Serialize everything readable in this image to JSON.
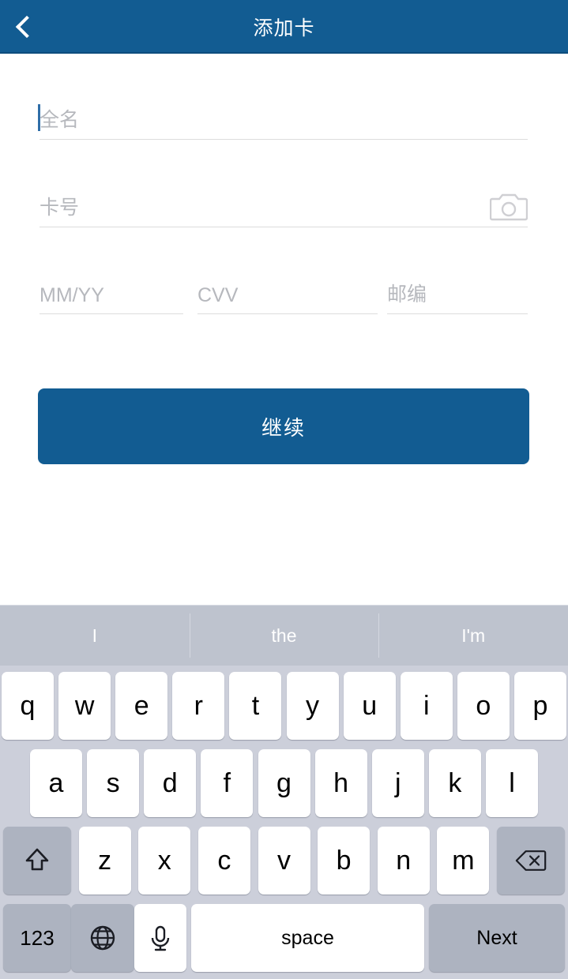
{
  "header": {
    "title": "添加卡",
    "back_icon": "chevron-left-icon",
    "background_color": "#125C92"
  },
  "form": {
    "fields": [
      {
        "name": "full-name",
        "placeholder": "全名",
        "value": "",
        "focused": true
      },
      {
        "name": "card-number",
        "placeholder": "卡号",
        "value": "",
        "focused": false,
        "trailing_icon": "camera-icon"
      },
      {
        "name": "expiry",
        "placeholder": "MM/YY",
        "value": "",
        "focused": false
      },
      {
        "name": "cvv",
        "placeholder": "CVV",
        "value": "",
        "focused": false
      },
      {
        "name": "postal-code",
        "placeholder": "邮编",
        "value": "",
        "focused": false
      }
    ],
    "submit_label": "继续",
    "submit_color": "#125C92"
  },
  "keyboard": {
    "suggestions": [
      "I",
      "the",
      "I'm"
    ],
    "row1": [
      "q",
      "w",
      "e",
      "r",
      "t",
      "y",
      "u",
      "i",
      "o",
      "p"
    ],
    "row2": [
      "a",
      "s",
      "d",
      "f",
      "g",
      "h",
      "j",
      "k",
      "l"
    ],
    "row3": [
      "z",
      "x",
      "c",
      "v",
      "b",
      "n",
      "m"
    ],
    "shift_icon": "shift-icon",
    "backspace_icon": "backspace-icon",
    "numbers_label": "123",
    "globe_icon": "globe-icon",
    "mic_icon": "microphone-icon",
    "space_label": "space",
    "return_label": "Next",
    "background_color": "#CCCFDA",
    "suggestion_bar_color": "#BEC3CE"
  }
}
